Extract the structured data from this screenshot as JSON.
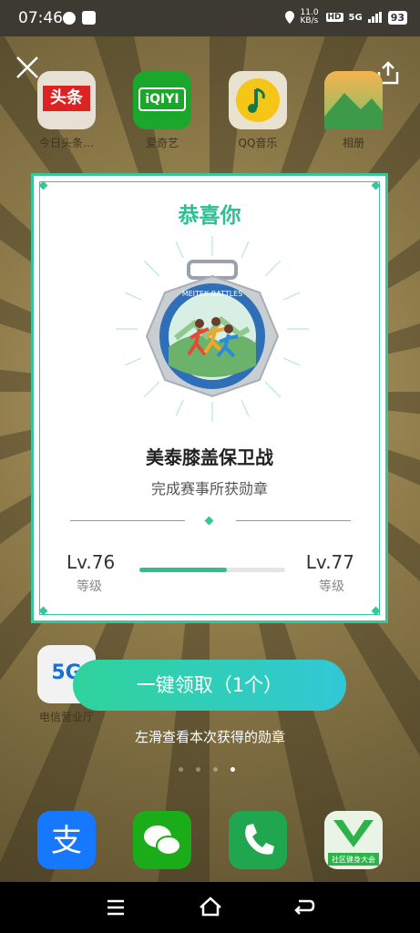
{
  "status": {
    "time": "07:46",
    "net_speed": "11.0 KB/s",
    "hd": "HD",
    "signal": "5G",
    "battery": "93"
  },
  "home_apps": [
    {
      "label": "今日头条…",
      "icon": "头条"
    },
    {
      "label": "爱奇艺",
      "icon": "iQIYI"
    },
    {
      "label": "QQ音乐",
      "icon": "music-icon"
    },
    {
      "label": "相册",
      "icon": "gallery-icon"
    },
    {
      "label": "电信营业厅",
      "icon": "5G"
    }
  ],
  "dock_apps": [
    "alipay-icon",
    "wechat-icon",
    "phone-icon",
    "社区健身大会"
  ],
  "modal": {
    "title": "恭喜你",
    "medal_text": "MEITEK BATTLES",
    "badge_name": "美泰膝盖保卫战",
    "badge_desc": "完成赛事所获勋章",
    "current_level": "Lv.76",
    "next_level": "Lv.77",
    "level_label": "等级",
    "progress": 0.6
  },
  "claim_button": "一键领取（1个）",
  "hint": "左滑查看本次获得的勋章",
  "page_dots": {
    "count": 4,
    "active": 3
  },
  "colors": {
    "accent": "#2cbf8f",
    "button_start": "#2fd39a",
    "button_end": "#31c8d6"
  }
}
